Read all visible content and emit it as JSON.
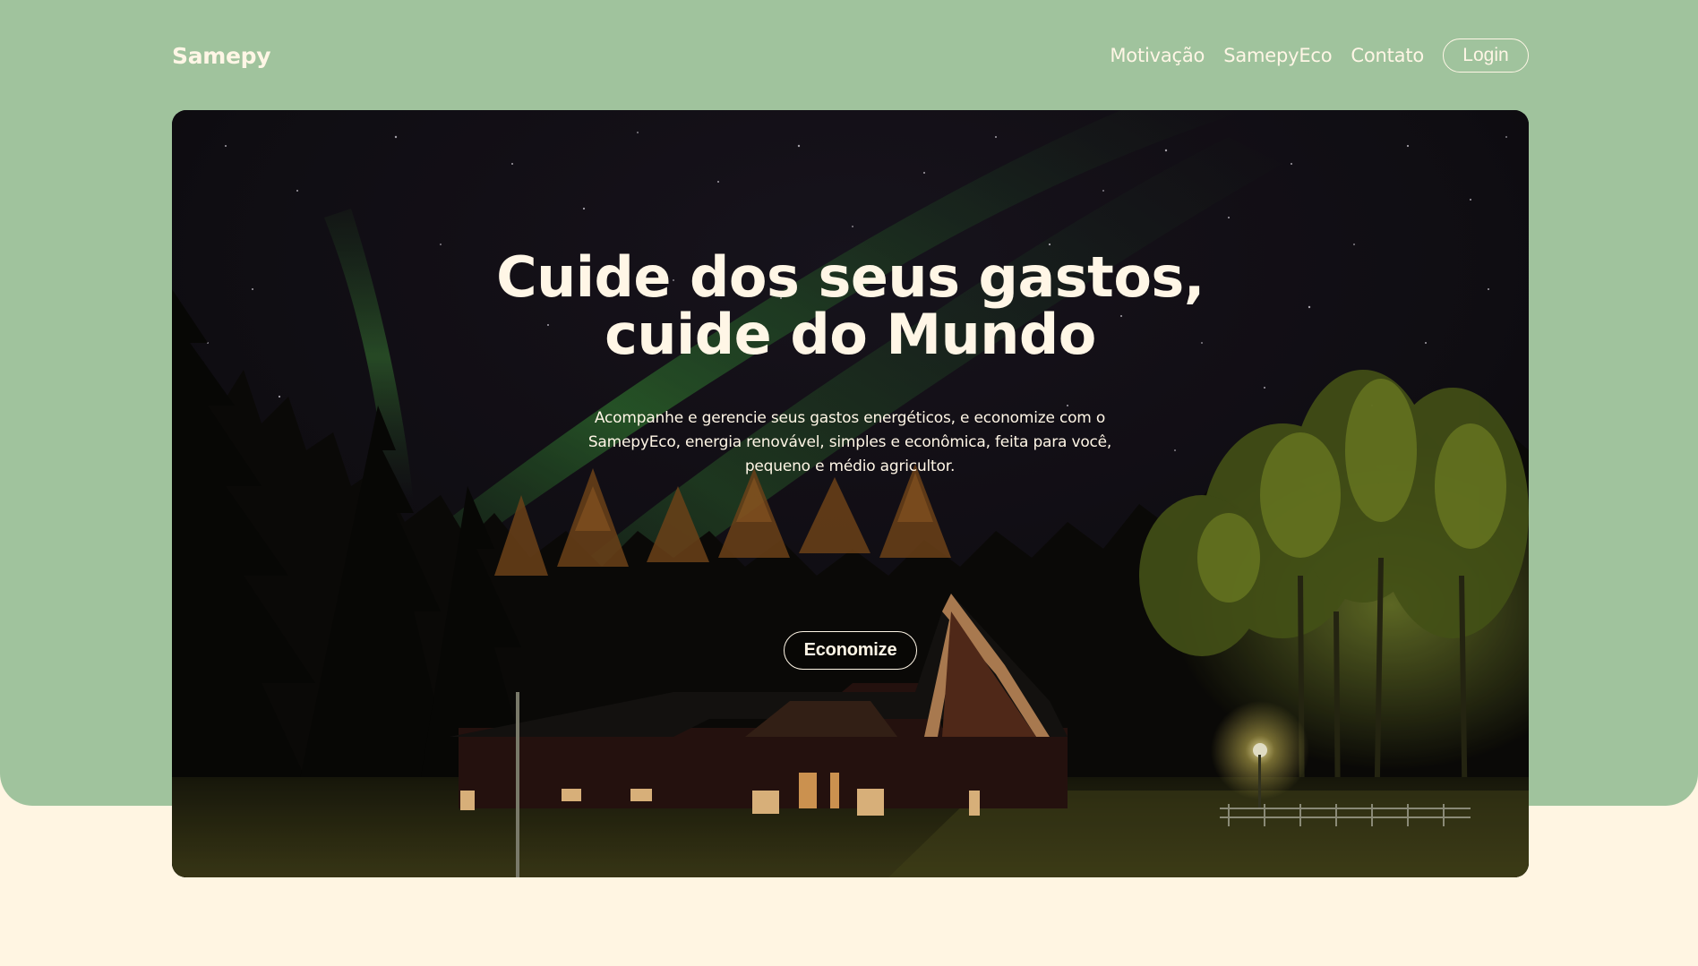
{
  "colors": {
    "top_band": "#a0c39d",
    "page_bg": "#fff5e2",
    "text_light": "#fff6e6"
  },
  "nav": {
    "brand": "Samepy",
    "links": [
      "Motivação",
      "SamepyEco",
      "Contato"
    ],
    "login_label": "Login"
  },
  "hero": {
    "title_line1": "Cuide dos seus gastos,",
    "title_line2": "cuide do Mundo",
    "description": "Acompanhe e gerencie seus gastos energéticos, e economize com o SamepyEco, energia renovável, simples e econômica, feita para você, pequeno e médio agricultor.",
    "cta_label": "Economize",
    "background_image": "aurora-night-forest-cabin"
  }
}
